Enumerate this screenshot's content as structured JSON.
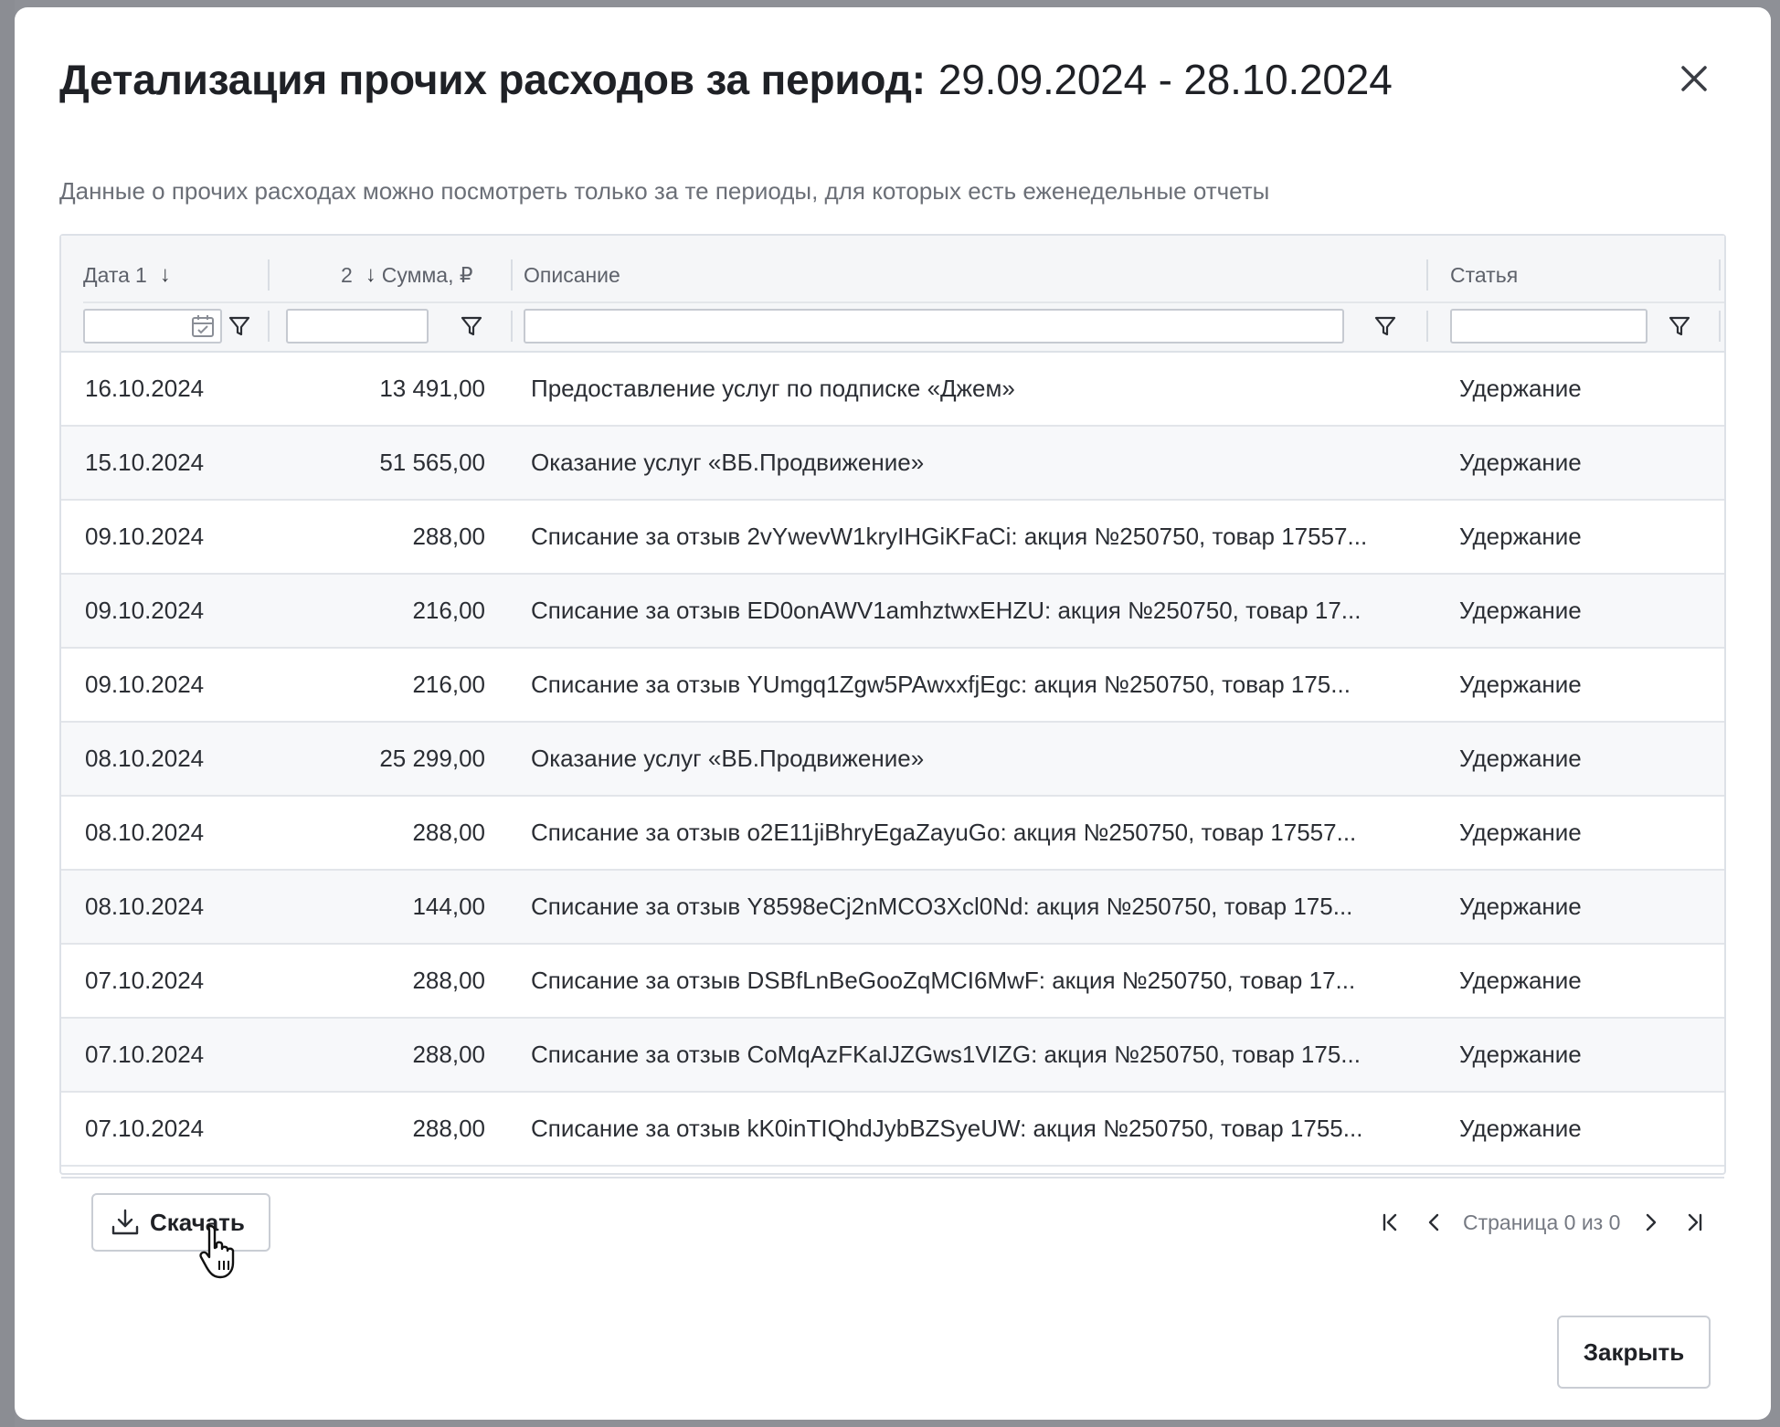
{
  "modal": {
    "title": "Детализация прочих расходов за период:",
    "period": "29.09.2024 - 28.10.2024",
    "subtitle": "Данные о прочих расходах можно посмотреть только за те периоды, для которых есть еженедельные отчеты",
    "close_icon": "close-icon"
  },
  "table": {
    "columns": {
      "date": {
        "label": "Дата",
        "sort_order": "1",
        "sort_icon": "arrow-down-icon"
      },
      "sum": {
        "label": "Сумма, ₽",
        "sort_order": "2",
        "sort_icon": "arrow-down-icon"
      },
      "description": {
        "label": "Описание"
      },
      "article": {
        "label": "Статья"
      }
    },
    "filters": {
      "date_value": "",
      "sum_value": "",
      "description_value": "",
      "article_value": "",
      "icons": [
        "calendar-icon",
        "funnel-icon"
      ]
    },
    "rows": [
      {
        "date": "16.10.2024",
        "sum": "13 491,00",
        "description": "Предоставление услуг по подписке «Джем»",
        "article": "Удержание"
      },
      {
        "date": "15.10.2024",
        "sum": "51 565,00",
        "description": "Оказание услуг «ВБ.Продвижение»",
        "article": "Удержание"
      },
      {
        "date": "09.10.2024",
        "sum": "288,00",
        "description": "Списание за отзыв 2vYwevW1kryIHGiKFaCi: акция №250750, товар 17557...",
        "article": "Удержание"
      },
      {
        "date": "09.10.2024",
        "sum": "216,00",
        "description": "Списание за отзыв ED0onAWV1amhztwxEHZU: акция №250750, товар 17...",
        "article": "Удержание"
      },
      {
        "date": "09.10.2024",
        "sum": "216,00",
        "description": "Списание за отзыв YUmgq1Zgw5PAwxxfjEgc: акция №250750, товар 175...",
        "article": "Удержание"
      },
      {
        "date": "08.10.2024",
        "sum": "25 299,00",
        "description": "Оказание услуг «ВБ.Продвижение»",
        "article": "Удержание"
      },
      {
        "date": "08.10.2024",
        "sum": "288,00",
        "description": "Списание за отзыв o2E11jiBhryEgaZayuGo: акция №250750, товар 17557...",
        "article": "Удержание"
      },
      {
        "date": "08.10.2024",
        "sum": "144,00",
        "description": "Списание за отзыв Y8598eCj2nMCO3Xcl0Nd: акция №250750, товар 175...",
        "article": "Удержание"
      },
      {
        "date": "07.10.2024",
        "sum": "288,00",
        "description": "Списание за отзыв DSBfLnBeGooZqMCI6MwF: акция №250750, товар 17...",
        "article": "Удержание"
      },
      {
        "date": "07.10.2024",
        "sum": "288,00",
        "description": "Списание за отзыв CoMqAzFKaIJZGws1VIZG: акция №250750, товар 175...",
        "article": "Удержание"
      },
      {
        "date": "07.10.2024",
        "sum": "288,00",
        "description": "Списание за отзыв kK0inTIQhdJybBZSyeUW: акция №250750, товар 1755...",
        "article": "Удержание"
      }
    ]
  },
  "footer": {
    "download_label": "Скачать",
    "download_icon": "download-icon",
    "pagination_text": "Страница 0 из 0",
    "pager_icons": [
      "first-page-icon",
      "prev-page-icon",
      "next-page-icon",
      "last-page-icon"
    ]
  },
  "actions": {
    "close_label": "Закрыть"
  },
  "colors": {
    "backdrop": "#8e9096",
    "header_bg": "#f5f6f8",
    "row_alt_bg": "#f7f8fa",
    "border": "#dde1e7",
    "text_primary": "#1f2126",
    "text_muted": "#6b6f77"
  }
}
